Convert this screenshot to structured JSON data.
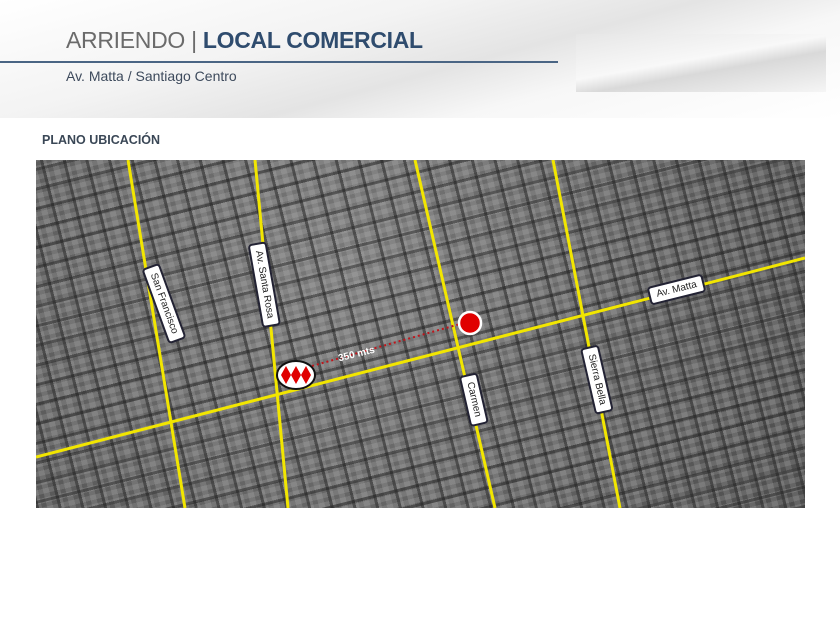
{
  "header": {
    "title_light": "ARRIENDO | ",
    "title_bold": "LOCAL COMERCIAL",
    "subtitle": "Av. Matta / Santiago Centro"
  },
  "section_title": "PLANO UBICACIÓN",
  "map": {
    "streets": [
      "San Francisco",
      "Av. Santa Rosa",
      "Carmen",
      "Sierra Bella",
      "Av. Matta"
    ],
    "distance_label": "350 mts",
    "road_color": "#f2e600",
    "marker_color": "#e00000",
    "metro_icon": "metro-santiago-icon",
    "location_icon": "red-dot-marker-icon"
  }
}
